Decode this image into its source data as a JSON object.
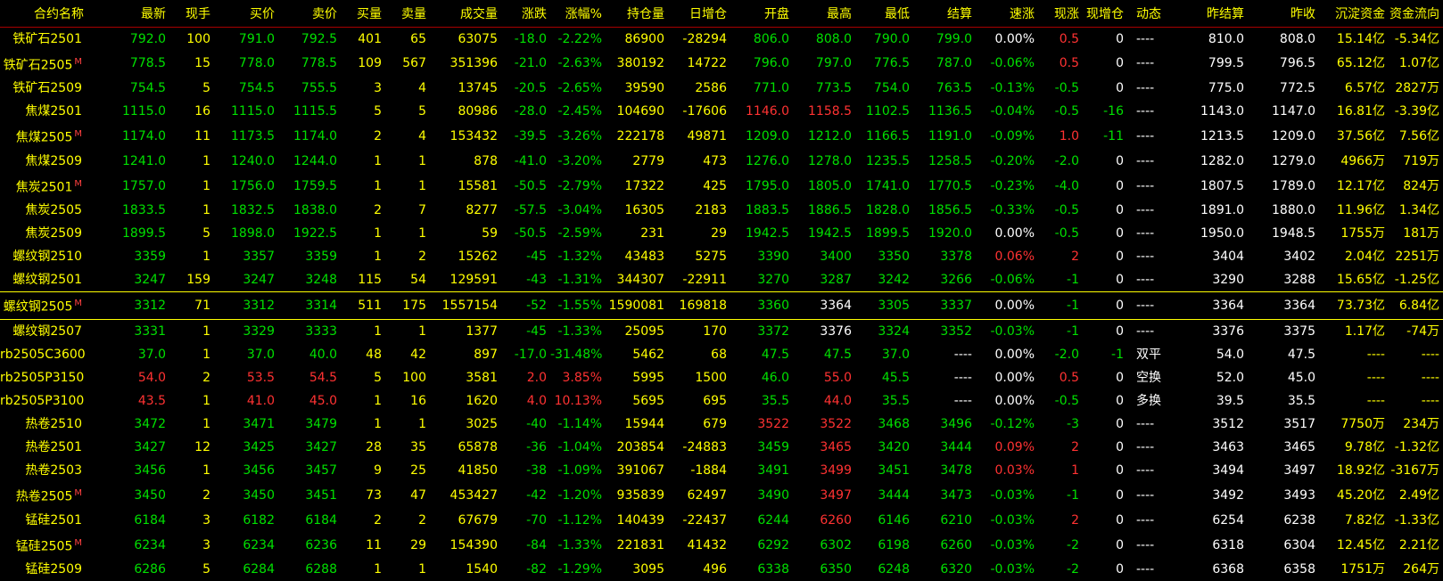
{
  "columns": [
    "合约名称",
    "最新",
    "现手",
    "买价",
    "卖价",
    "买量",
    "卖量",
    "成交量",
    "涨跌",
    "涨幅%",
    "持仓量",
    "日增仓",
    "开盘",
    "最高",
    "最低",
    "结算",
    "速涨",
    "现涨",
    "现增仓",
    "动态",
    "昨结算",
    "昨收",
    "沉淀资金",
    "资金流向"
  ],
  "colors": {
    "up": "#ff3232",
    "down": "#00e000",
    "flat": "#ffffff",
    "neutral": "#ffff00",
    "header_line": "#a80000"
  },
  "selected_row": 11,
  "rows": [
    {
      "name": "铁矿石2501",
      "main": false,
      "dir": "down",
      "last": "792.0",
      "cur": "100",
      "bid": "791.0",
      "ask": "792.5",
      "bidv": "401",
      "askv": "65",
      "vol": "63075",
      "chg": "-18.0",
      "pct": "-2.22%",
      "oi": "86900",
      "doi": "-28294",
      "open": "806.0",
      "ho": "down",
      "high": "808.0",
      "hh": "down",
      "low": "790.0",
      "hl": "down",
      "settle": "799.0",
      "hs": "down",
      "speed": "0.00%",
      "hsp": "flat",
      "tick": "0.5",
      "ht": "up",
      "toi": "0",
      "act": "----",
      "pset": "810.0",
      "pclose": "808.0",
      "cap": "15.14亿",
      "flow": "-5.34亿"
    },
    {
      "name": "铁矿石2505",
      "main": true,
      "dir": "down",
      "last": "778.5",
      "cur": "15",
      "bid": "778.0",
      "ask": "778.5",
      "bidv": "109",
      "askv": "567",
      "vol": "351396",
      "chg": "-21.0",
      "pct": "-2.63%",
      "oi": "380192",
      "doi": "14722",
      "open": "796.0",
      "ho": "down",
      "high": "797.0",
      "hh": "down",
      "low": "776.5",
      "hl": "down",
      "settle": "787.0",
      "hs": "down",
      "speed": "-0.06%",
      "hsp": "down",
      "tick": "0.5",
      "ht": "up",
      "toi": "0",
      "act": "----",
      "pset": "799.5",
      "pclose": "796.5",
      "cap": "65.12亿",
      "flow": "1.07亿"
    },
    {
      "name": "铁矿石2509",
      "main": false,
      "dir": "down",
      "last": "754.5",
      "cur": "5",
      "bid": "754.5",
      "ask": "755.5",
      "bidv": "3",
      "askv": "4",
      "vol": "13745",
      "chg": "-20.5",
      "pct": "-2.65%",
      "oi": "39590",
      "doi": "2586",
      "open": "771.0",
      "ho": "down",
      "high": "773.5",
      "hh": "down",
      "low": "754.0",
      "hl": "down",
      "settle": "763.5",
      "hs": "down",
      "speed": "-0.13%",
      "hsp": "down",
      "tick": "-0.5",
      "ht": "down",
      "toi": "0",
      "act": "----",
      "pset": "775.0",
      "pclose": "772.5",
      "cap": "6.57亿",
      "flow": "2827万"
    },
    {
      "name": "焦煤2501",
      "main": false,
      "dir": "down",
      "last": "1115.0",
      "cur": "16",
      "bid": "1115.0",
      "ask": "1115.5",
      "bidv": "5",
      "askv": "5",
      "vol": "80986",
      "chg": "-28.0",
      "pct": "-2.45%",
      "oi": "104690",
      "doi": "-17606",
      "open": "1146.0",
      "ho": "up",
      "high": "1158.5",
      "hh": "up",
      "low": "1102.5",
      "hl": "down",
      "settle": "1136.5",
      "hs": "down",
      "speed": "-0.04%",
      "hsp": "down",
      "tick": "-0.5",
      "ht": "down",
      "toi": "-16",
      "act": "----",
      "pset": "1143.0",
      "pclose": "1147.0",
      "cap": "16.81亿",
      "flow": "-3.39亿"
    },
    {
      "name": "焦煤2505",
      "main": true,
      "dir": "down",
      "last": "1174.0",
      "cur": "11",
      "bid": "1173.5",
      "ask": "1174.0",
      "bidv": "2",
      "askv": "4",
      "vol": "153432",
      "chg": "-39.5",
      "pct": "-3.26%",
      "oi": "222178",
      "doi": "49871",
      "open": "1209.0",
      "ho": "down",
      "high": "1212.0",
      "hh": "down",
      "low": "1166.5",
      "hl": "down",
      "settle": "1191.0",
      "hs": "down",
      "speed": "-0.09%",
      "hsp": "down",
      "tick": "1.0",
      "ht": "up",
      "toi": "-11",
      "act": "----",
      "pset": "1213.5",
      "pclose": "1209.0",
      "cap": "37.56亿",
      "flow": "7.56亿"
    },
    {
      "name": "焦煤2509",
      "main": false,
      "dir": "down",
      "last": "1241.0",
      "cur": "1",
      "bid": "1240.0",
      "ask": "1244.0",
      "bidv": "1",
      "askv": "1",
      "vol": "878",
      "chg": "-41.0",
      "pct": "-3.20%",
      "oi": "2779",
      "doi": "473",
      "open": "1276.0",
      "ho": "down",
      "high": "1278.0",
      "hh": "down",
      "low": "1235.5",
      "hl": "down",
      "settle": "1258.5",
      "hs": "down",
      "speed": "-0.20%",
      "hsp": "down",
      "tick": "-2.0",
      "ht": "down",
      "toi": "0",
      "act": "----",
      "pset": "1282.0",
      "pclose": "1279.0",
      "cap": "4966万",
      "flow": "719万"
    },
    {
      "name": "焦炭2501",
      "main": true,
      "dir": "down",
      "last": "1757.0",
      "cur": "1",
      "bid": "1756.0",
      "ask": "1759.5",
      "bidv": "1",
      "askv": "1",
      "vol": "15581",
      "chg": "-50.5",
      "pct": "-2.79%",
      "oi": "17322",
      "doi": "425",
      "open": "1795.0",
      "ho": "down",
      "high": "1805.0",
      "hh": "down",
      "low": "1741.0",
      "hl": "down",
      "settle": "1770.5",
      "hs": "down",
      "speed": "-0.23%",
      "hsp": "down",
      "tick": "-4.0",
      "ht": "down",
      "toi": "0",
      "act": "----",
      "pset": "1807.5",
      "pclose": "1789.0",
      "cap": "12.17亿",
      "flow": "824万"
    },
    {
      "name": "焦炭2505",
      "main": false,
      "dir": "down",
      "last": "1833.5",
      "cur": "1",
      "bid": "1832.5",
      "ask": "1838.0",
      "bidv": "2",
      "askv": "7",
      "vol": "8277",
      "chg": "-57.5",
      "pct": "-3.04%",
      "oi": "16305",
      "doi": "2183",
      "open": "1883.5",
      "ho": "down",
      "high": "1886.5",
      "hh": "down",
      "low": "1828.0",
      "hl": "down",
      "settle": "1856.5",
      "hs": "down",
      "speed": "-0.33%",
      "hsp": "down",
      "tick": "-0.5",
      "ht": "down",
      "toi": "0",
      "act": "----",
      "pset": "1891.0",
      "pclose": "1880.0",
      "cap": "11.96亿",
      "flow": "1.34亿"
    },
    {
      "name": "焦炭2509",
      "main": false,
      "dir": "down",
      "last": "1899.5",
      "cur": "5",
      "bid": "1898.0",
      "ask": "1922.5",
      "bidv": "1",
      "askv": "1",
      "vol": "59",
      "chg": "-50.5",
      "pct": "-2.59%",
      "oi": "231",
      "doi": "29",
      "open": "1942.5",
      "ho": "down",
      "high": "1942.5",
      "hh": "down",
      "low": "1899.5",
      "hl": "down",
      "settle": "1920.0",
      "hs": "down",
      "speed": "0.00%",
      "hsp": "flat",
      "tick": "-0.5",
      "ht": "down",
      "toi": "0",
      "act": "----",
      "pset": "1950.0",
      "pclose": "1948.5",
      "cap": "1755万",
      "flow": "181万"
    },
    {
      "name": "螺纹钢2510",
      "main": false,
      "dir": "down",
      "last": "3359",
      "cur": "1",
      "bid": "3357",
      "ask": "3359",
      "bidv": "1",
      "askv": "2",
      "vol": "15262",
      "chg": "-45",
      "pct": "-1.32%",
      "oi": "43483",
      "doi": "5275",
      "open": "3390",
      "ho": "down",
      "high": "3400",
      "hh": "down",
      "low": "3350",
      "hl": "down",
      "settle": "3378",
      "hs": "down",
      "speed": "0.06%",
      "hsp": "up",
      "tick": "2",
      "ht": "up",
      "toi": "0",
      "act": "----",
      "pset": "3404",
      "pclose": "3402",
      "cap": "2.04亿",
      "flow": "2251万"
    },
    {
      "name": "螺纹钢2501",
      "main": false,
      "dir": "down",
      "last": "3247",
      "cur": "159",
      "bid": "3247",
      "ask": "3248",
      "bidv": "115",
      "askv": "54",
      "vol": "129591",
      "chg": "-43",
      "pct": "-1.31%",
      "oi": "344307",
      "doi": "-22911",
      "open": "3270",
      "ho": "down",
      "high": "3287",
      "hh": "down",
      "low": "3242",
      "hl": "down",
      "settle": "3266",
      "hs": "down",
      "speed": "-0.06%",
      "hsp": "down",
      "tick": "-1",
      "ht": "down",
      "toi": "0",
      "act": "----",
      "pset": "3290",
      "pclose": "3288",
      "cap": "15.65亿",
      "flow": "-1.25亿"
    },
    {
      "name": "螺纹钢2505",
      "main": true,
      "dir": "down",
      "last": "3312",
      "cur": "71",
      "bid": "3312",
      "ask": "3314",
      "bidv": "511",
      "askv": "175",
      "vol": "1557154",
      "chg": "-52",
      "pct": "-1.55%",
      "oi": "1590081",
      "doi": "169818",
      "open": "3360",
      "ho": "down",
      "high": "3364",
      "hh": "flat",
      "low": "3305",
      "hl": "down",
      "settle": "3337",
      "hs": "down",
      "speed": "0.00%",
      "hsp": "flat",
      "tick": "-1",
      "ht": "down",
      "toi": "0",
      "act": "----",
      "pset": "3364",
      "pclose": "3364",
      "cap": "73.73亿",
      "flow": "6.84亿"
    },
    {
      "name": "螺纹钢2507",
      "main": false,
      "dir": "down",
      "last": "3331",
      "cur": "1",
      "bid": "3329",
      "ask": "3333",
      "bidv": "1",
      "askv": "1",
      "vol": "1377",
      "chg": "-45",
      "pct": "-1.33%",
      "oi": "25095",
      "doi": "170",
      "open": "3372",
      "ho": "down",
      "high": "3376",
      "hh": "flat",
      "low": "3324",
      "hl": "down",
      "settle": "3352",
      "hs": "down",
      "speed": "-0.03%",
      "hsp": "down",
      "tick": "-1",
      "ht": "down",
      "toi": "0",
      "act": "----",
      "pset": "3376",
      "pclose": "3375",
      "cap": "1.17亿",
      "flow": "-74万"
    },
    {
      "name": "rb2505C3600",
      "main": false,
      "dir": "down",
      "last": "37.0",
      "cur": "1",
      "bid": "37.0",
      "ask": "40.0",
      "bidv": "48",
      "askv": "42",
      "vol": "897",
      "chg": "-17.0",
      "pct": "-31.48%",
      "oi": "5462",
      "doi": "68",
      "open": "47.5",
      "ho": "down",
      "high": "47.5",
      "hh": "down",
      "low": "37.0",
      "hl": "down",
      "settle": "----",
      "hs": "flat",
      "speed": "0.00%",
      "hsp": "flat",
      "tick": "-2.0",
      "ht": "down",
      "toi": "-1",
      "act": "双平",
      "pset": "54.0",
      "pclose": "47.5",
      "cap": "----",
      "flow": "----"
    },
    {
      "name": "rb2505P3150",
      "main": false,
      "dir": "up",
      "last": "54.0",
      "cur": "2",
      "bid": "53.5",
      "ask": "54.5",
      "bidv": "5",
      "askv": "100",
      "vol": "3581",
      "chg": "2.0",
      "pct": "3.85%",
      "oi": "5995",
      "doi": "1500",
      "open": "46.0",
      "ho": "down",
      "high": "55.0",
      "hh": "up",
      "low": "45.5",
      "hl": "down",
      "settle": "----",
      "hs": "flat",
      "speed": "0.00%",
      "hsp": "flat",
      "tick": "0.5",
      "ht": "up",
      "toi": "0",
      "act": "空换",
      "pset": "52.0",
      "pclose": "45.0",
      "cap": "----",
      "flow": "----"
    },
    {
      "name": "rb2505P3100",
      "main": false,
      "dir": "up",
      "last": "43.5",
      "cur": "1",
      "bid": "41.0",
      "ask": "45.0",
      "bidv": "1",
      "askv": "16",
      "vol": "1620",
      "chg": "4.0",
      "pct": "10.13%",
      "oi": "5695",
      "doi": "695",
      "open": "35.5",
      "ho": "down",
      "high": "44.0",
      "hh": "up",
      "low": "35.5",
      "hl": "down",
      "settle": "----",
      "hs": "flat",
      "speed": "0.00%",
      "hsp": "flat",
      "tick": "-0.5",
      "ht": "down",
      "toi": "0",
      "act": "多换",
      "pset": "39.5",
      "pclose": "35.5",
      "cap": "----",
      "flow": "----"
    },
    {
      "name": "热卷2510",
      "main": false,
      "dir": "down",
      "last": "3472",
      "cur": "1",
      "bid": "3471",
      "ask": "3479",
      "bidv": "1",
      "askv": "1",
      "vol": "3025",
      "chg": "-40",
      "pct": "-1.14%",
      "oi": "15944",
      "doi": "679",
      "open": "3522",
      "ho": "up",
      "high": "3522",
      "hh": "up",
      "low": "3468",
      "hl": "down",
      "settle": "3496",
      "hs": "down",
      "speed": "-0.12%",
      "hsp": "down",
      "tick": "-3",
      "ht": "down",
      "toi": "0",
      "act": "----",
      "pset": "3512",
      "pclose": "3517",
      "cap": "7750万",
      "flow": "234万"
    },
    {
      "name": "热卷2501",
      "main": false,
      "dir": "down",
      "last": "3427",
      "cur": "12",
      "bid": "3425",
      "ask": "3427",
      "bidv": "28",
      "askv": "35",
      "vol": "65878",
      "chg": "-36",
      "pct": "-1.04%",
      "oi": "203854",
      "doi": "-24883",
      "open": "3459",
      "ho": "down",
      "high": "3465",
      "hh": "up",
      "low": "3420",
      "hl": "down",
      "settle": "3444",
      "hs": "down",
      "speed": "0.09%",
      "hsp": "up",
      "tick": "2",
      "ht": "up",
      "toi": "0",
      "act": "----",
      "pset": "3463",
      "pclose": "3465",
      "cap": "9.78亿",
      "flow": "-1.32亿"
    },
    {
      "name": "热卷2503",
      "main": false,
      "dir": "down",
      "last": "3456",
      "cur": "1",
      "bid": "3456",
      "ask": "3457",
      "bidv": "9",
      "askv": "25",
      "vol": "41850",
      "chg": "-38",
      "pct": "-1.09%",
      "oi": "391067",
      "doi": "-1884",
      "open": "3491",
      "ho": "down",
      "high": "3499",
      "hh": "up",
      "low": "3451",
      "hl": "down",
      "settle": "3478",
      "hs": "down",
      "speed": "0.03%",
      "hsp": "up",
      "tick": "1",
      "ht": "up",
      "toi": "0",
      "act": "----",
      "pset": "3494",
      "pclose": "3497",
      "cap": "18.92亿",
      "flow": "-3167万"
    },
    {
      "name": "热卷2505",
      "main": true,
      "dir": "down",
      "last": "3450",
      "cur": "2",
      "bid": "3450",
      "ask": "3451",
      "bidv": "73",
      "askv": "47",
      "vol": "453427",
      "chg": "-42",
      "pct": "-1.20%",
      "oi": "935839",
      "doi": "62497",
      "open": "3490",
      "ho": "down",
      "high": "3497",
      "hh": "up",
      "low": "3444",
      "hl": "down",
      "settle": "3473",
      "hs": "down",
      "speed": "-0.03%",
      "hsp": "down",
      "tick": "-1",
      "ht": "down",
      "toi": "0",
      "act": "----",
      "pset": "3492",
      "pclose": "3493",
      "cap": "45.20亿",
      "flow": "2.49亿"
    },
    {
      "name": "锰硅2501",
      "main": false,
      "dir": "down",
      "last": "6184",
      "cur": "3",
      "bid": "6182",
      "ask": "6184",
      "bidv": "2",
      "askv": "2",
      "vol": "67679",
      "chg": "-70",
      "pct": "-1.12%",
      "oi": "140439",
      "doi": "-22437",
      "open": "6244",
      "ho": "down",
      "high": "6260",
      "hh": "up",
      "low": "6146",
      "hl": "down",
      "settle": "6210",
      "hs": "down",
      "speed": "-0.03%",
      "hsp": "down",
      "tick": "2",
      "ht": "up",
      "toi": "0",
      "act": "----",
      "pset": "6254",
      "pclose": "6238",
      "cap": "7.82亿",
      "flow": "-1.33亿"
    },
    {
      "name": "锰硅2505",
      "main": true,
      "dir": "down",
      "last": "6234",
      "cur": "3",
      "bid": "6234",
      "ask": "6236",
      "bidv": "11",
      "askv": "29",
      "vol": "154390",
      "chg": "-84",
      "pct": "-1.33%",
      "oi": "221831",
      "doi": "41432",
      "open": "6292",
      "ho": "down",
      "high": "6302",
      "hh": "down",
      "low": "6198",
      "hl": "down",
      "settle": "6260",
      "hs": "down",
      "speed": "-0.03%",
      "hsp": "down",
      "tick": "-2",
      "ht": "down",
      "toi": "0",
      "act": "----",
      "pset": "6318",
      "pclose": "6304",
      "cap": "12.45亿",
      "flow": "2.21亿"
    },
    {
      "name": "锰硅2509",
      "main": false,
      "dir": "down",
      "last": "6286",
      "cur": "5",
      "bid": "6284",
      "ask": "6288",
      "bidv": "1",
      "askv": "1",
      "vol": "1540",
      "chg": "-82",
      "pct": "-1.29%",
      "oi": "3095",
      "doi": "496",
      "open": "6338",
      "ho": "down",
      "high": "6350",
      "hh": "down",
      "low": "6248",
      "hl": "down",
      "settle": "6320",
      "hs": "down",
      "speed": "-0.03%",
      "hsp": "down",
      "tick": "-2",
      "ht": "down",
      "toi": "0",
      "act": "----",
      "pset": "6368",
      "pclose": "6358",
      "cap": "1751万",
      "flow": "264万"
    }
  ]
}
